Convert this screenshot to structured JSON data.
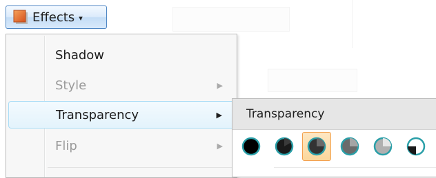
{
  "effects_button": {
    "label": "Effects",
    "icon": "effects-square-icon",
    "caret": "▾"
  },
  "menu": {
    "items": [
      {
        "label": "Shadow",
        "disabled": false,
        "has_submenu": false,
        "selected": false
      },
      {
        "label": "Style",
        "disabled": true,
        "has_submenu": true,
        "selected": false
      },
      {
        "label": "Transparency",
        "disabled": false,
        "has_submenu": true,
        "selected": true
      },
      {
        "label": "Flip",
        "disabled": true,
        "has_submenu": true,
        "selected": false
      }
    ],
    "arrow": "▶"
  },
  "submenu": {
    "title": "Transparency",
    "swatches": [
      {
        "name": "transparency-0-swatch",
        "selected": false
      },
      {
        "name": "transparency-20-swatch",
        "selected": false
      },
      {
        "name": "transparency-40-swatch",
        "selected": true
      },
      {
        "name": "transparency-60-swatch",
        "selected": false
      },
      {
        "name": "transparency-80-swatch",
        "selected": false
      },
      {
        "name": "transparency-100-swatch",
        "selected": false
      }
    ]
  },
  "colors": {
    "accent_border": "#4f87c4",
    "selection_border": "#aaddf6",
    "swatch_selected_border": "#f3a04c",
    "swatch_ring": "#2a9fa8"
  }
}
